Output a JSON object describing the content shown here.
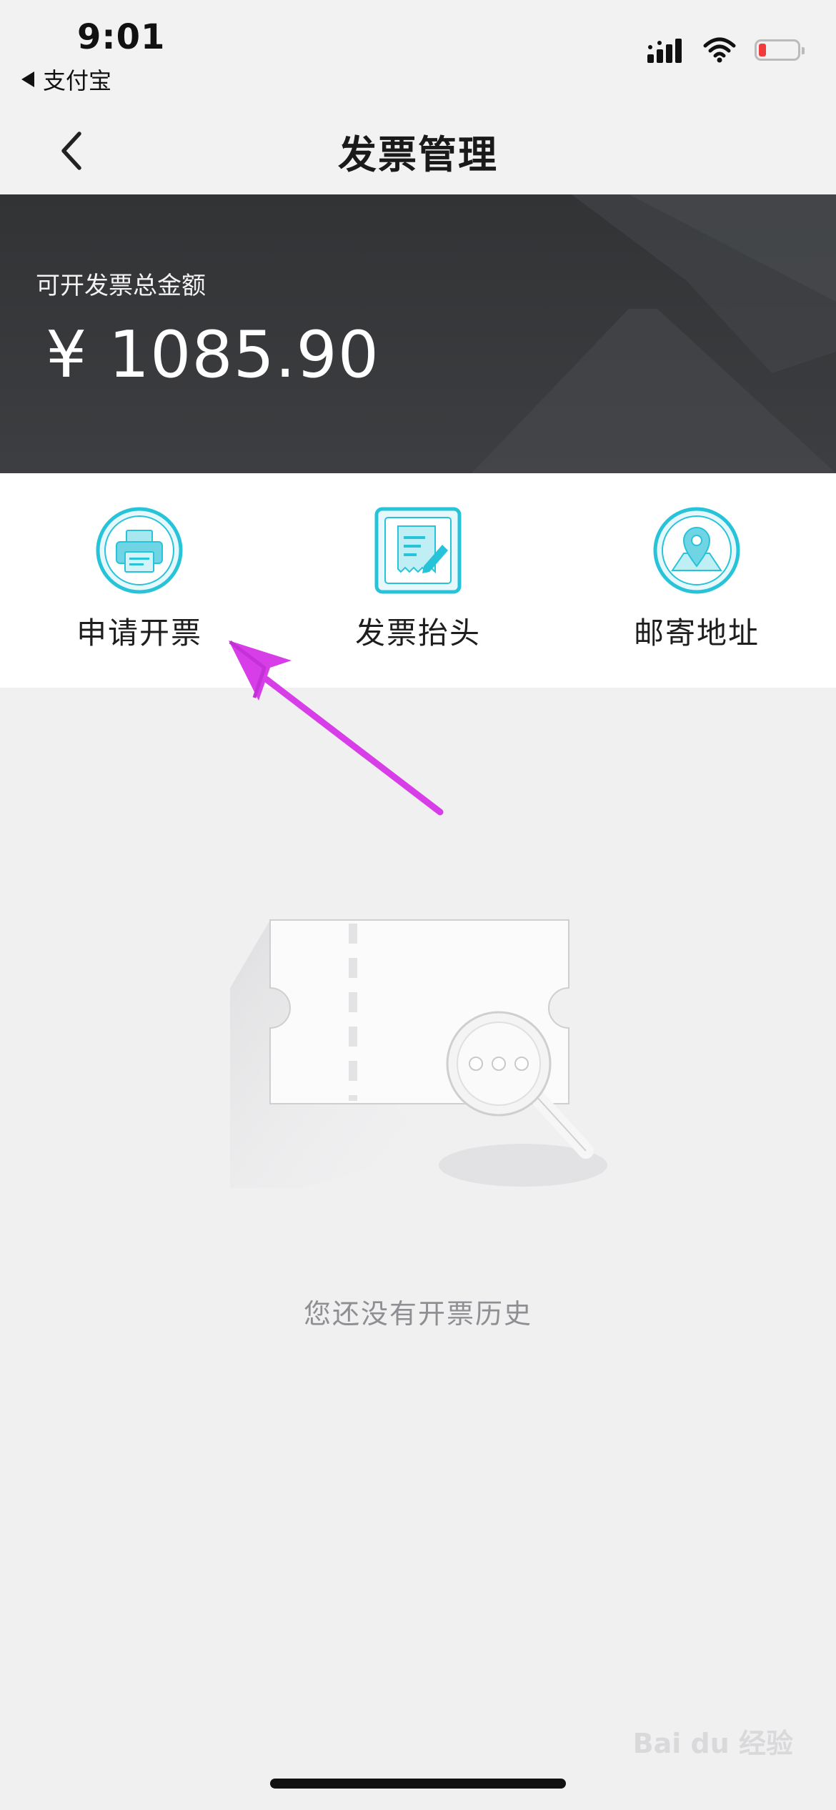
{
  "status_bar": {
    "time": "9:01",
    "back_app_label": "支付宝",
    "icons": [
      "cellular-signal-icon",
      "wifi-icon",
      "battery-low-icon"
    ]
  },
  "nav": {
    "title": "发票管理",
    "back_icon": "chevron-left-icon"
  },
  "balance": {
    "label": "可开发票总金额",
    "amount": "¥ 1085.90"
  },
  "actions": [
    {
      "label": "申请开票",
      "icon": "printer-icon"
    },
    {
      "label": "发票抬头",
      "icon": "invoice-title-icon"
    },
    {
      "label": "邮寄地址",
      "icon": "map-pin-icon"
    }
  ],
  "empty_state": {
    "message": "您还没有开票历史",
    "illustration": "ticket-search-illustration"
  },
  "annotation": {
    "color": "#d83ee8",
    "icon": "annotation-arrow"
  },
  "watermark": "Bai du 经验",
  "colors": {
    "accent": "#27c3d9",
    "card_background": "#323335",
    "page_background": "#f0f0f1"
  }
}
